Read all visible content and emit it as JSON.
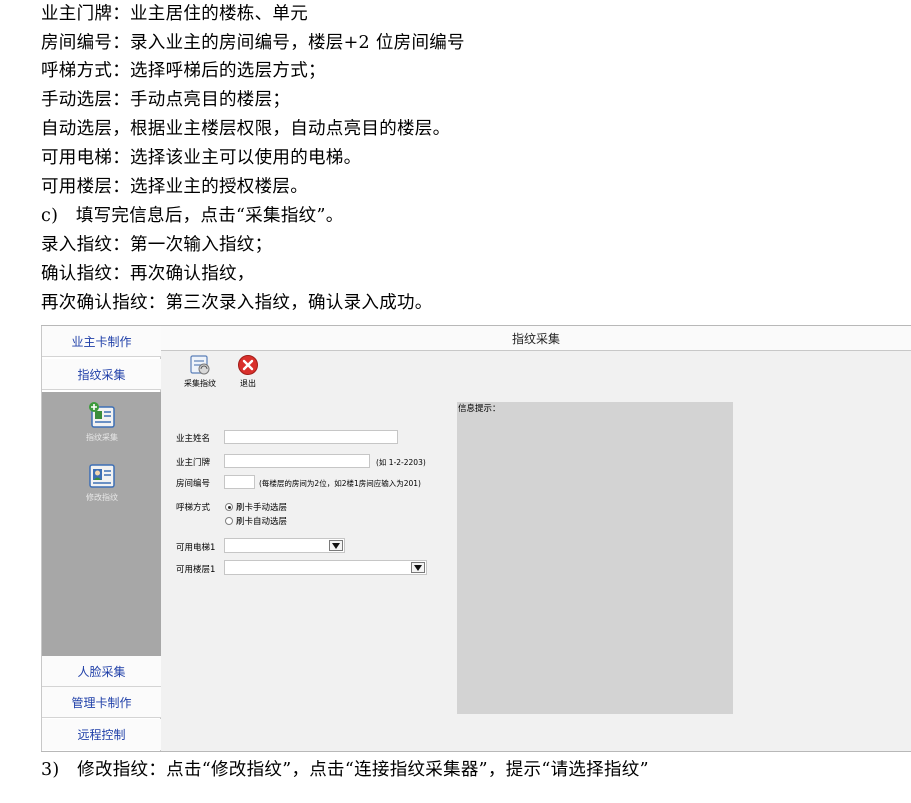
{
  "doc": {
    "lines": [
      "业主门牌：业主居住的楼栋、单元",
      "房间编号：录入业主的房间编号，楼层+2 位房间编号",
      "呼梯方式：选择呼梯后的选层方式；",
      "手动选层：手动点亮目的楼层；",
      "自动选层，根据业主楼层权限，自动点亮目的楼层。",
      "可用电梯：选择该业主可以使用的电梯。",
      "可用楼层：选择业主的授权楼层。",
      "c)   填写完信息后，点击“采集指纹”。",
      "录入指纹：第一次输入指纹；",
      "确认指纹：再次确认指纹，",
      "再次确认指纹：第三次录入指纹，确认录入成功。"
    ],
    "caption": "3)   修改指纹：点击“修改指纹”，点击“连接指纹采集器”，提示“请选择指纹”"
  },
  "app": {
    "title": "指纹采集",
    "sidebar": {
      "top_items": [
        "业主卡制作",
        "指纹采集"
      ],
      "icon_items": [
        "指纹采集",
        "修改指纹"
      ],
      "bottom_items": [
        "人脸采集",
        "管理卡制作",
        "远程控制"
      ]
    },
    "toolbar": {
      "collect_label": "采集指纹",
      "exit_label": "退出"
    },
    "form": {
      "owner_name_label": "业主姓名",
      "owner_name_value": "",
      "door_label": "业主门牌",
      "door_value": "",
      "door_hint": "(如 1-2-2203)",
      "room_label": "房间编号",
      "room_value": "",
      "room_hint": "(每楼层的房间为2位，如2楼1房间应输入为201)",
      "call_mode_label": "呼梯方式",
      "call_mode_options": [
        "刷卡手动选层",
        "刷卡自动选层"
      ],
      "call_mode_selected": 0,
      "elevator_label": "可用电梯1",
      "elevator_value": "",
      "floor_label": "可用楼层1",
      "floor_value": ""
    },
    "info_label": "信息提示："
  },
  "colors": {
    "side_text": "#1f3fa8",
    "side_gray": "#a7a7a7",
    "info_box": "#d3d3d3",
    "exit_icon": "#d9302c"
  }
}
